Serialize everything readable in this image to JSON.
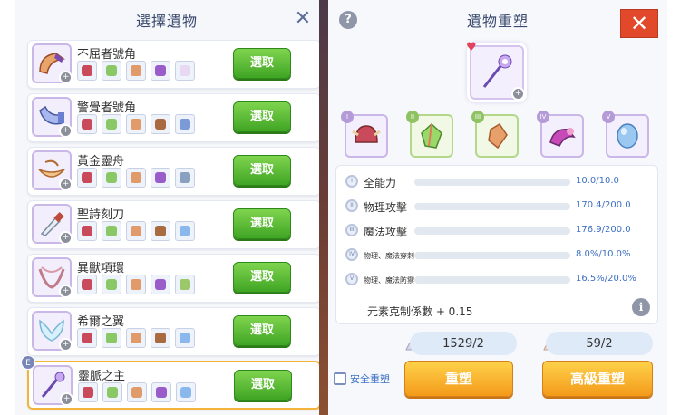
{
  "left_panel": {
    "title": "選擇遺物",
    "close_symbol": "✕"
  },
  "relic_list": [
    {
      "name": "不屈者號角",
      "button": "選取",
      "mats": [
        "#c94a5a",
        "#8ac765",
        "#e19a6a",
        "#9a5cc9",
        "#e8d8f2"
      ]
    },
    {
      "name": "警覺者號角",
      "button": "選取",
      "mats": [
        "#c94a5a",
        "#8ac765",
        "#e19a6a",
        "#a86a3e",
        "#7a9ad8"
      ]
    },
    {
      "name": "黃金靈舟",
      "button": "選取",
      "mats": [
        "#c94a5a",
        "#8ac765",
        "#e19a6a",
        "#9a5cc9",
        "#8aa0c0"
      ]
    },
    {
      "name": "聖詩刻刀",
      "button": "選取",
      "mats": [
        "#c94a5a",
        "#8ac765",
        "#e19a6a",
        "#a86a3e",
        "#8ab8ec"
      ]
    },
    {
      "name": "異獸項環",
      "button": "選取",
      "mats": [
        "#c94a5a",
        "#8ac765",
        "#e19a6a",
        "#9a5cc9",
        "#9ac86a"
      ]
    },
    {
      "name": "希爾之翼",
      "button": "選取",
      "mats": [
        "#c94a5a",
        "#8ac765",
        "#e19a6a",
        "#a86a3e",
        "#8ab8ec"
      ]
    },
    {
      "name": "靈脈之主",
      "button": "選取",
      "badge": "E",
      "mats": [
        "#c94a5a",
        "#8ac765",
        "#e19a6a",
        "#9a5cc9",
        "#8ab8ec"
      ]
    }
  ],
  "right_panel": {
    "title": "遺物重塑",
    "help": "?",
    "close": "✕"
  },
  "slots": [
    {
      "num": "I"
    },
    {
      "num": "II"
    },
    {
      "num": "III"
    },
    {
      "num": "IV"
    },
    {
      "num": "V"
    }
  ],
  "stats": [
    {
      "label": "全能力",
      "value": "10.0/10.0",
      "ratio": 1.0
    },
    {
      "label": "物理攻擊",
      "value": "170.4/200.0",
      "ratio": 0.852
    },
    {
      "label": "魔法攻擊",
      "value": "176.9/200.0",
      "ratio": 0.8845
    },
    {
      "label": "物理、魔法穿刺",
      "value": "8.0%/10.0%",
      "ratio": 0.8
    },
    {
      "label": "物理、魔法防禦",
      "value": "16.5%/20.0%",
      "ratio": 0.825
    }
  ],
  "coef": "元素克制係數 + 0.15",
  "info": "i",
  "costs": [
    "1529/2",
    "59/2"
  ],
  "safe_label": "安全重塑",
  "buttons": {
    "reforge": "重塑",
    "advanced": "高級重塑"
  }
}
